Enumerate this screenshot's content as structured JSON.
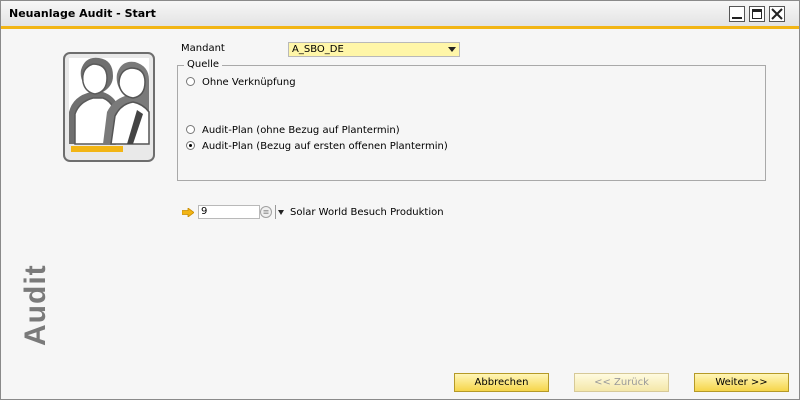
{
  "window": {
    "title": "Neuanlage Audit - Start"
  },
  "sidebar": {
    "label": "Audit",
    "icon": "users-icon"
  },
  "form": {
    "mandant_label": "Mandant",
    "mandant_value": "A_SBO_DE",
    "source_group_title": "Quelle",
    "radio_options": [
      {
        "label": "Ohne Verknüpfung",
        "selected": false
      },
      {
        "label": "Audit-Plan (ohne Bezug auf Plantermin)",
        "selected": false
      },
      {
        "label": "Audit-Plan (Bezug auf ersten offenen Plantermin)",
        "selected": true
      }
    ],
    "plan_number": "9",
    "plan_description": "Solar World Besuch Produktion"
  },
  "buttons": {
    "cancel": "Abbrechen",
    "back": "<< Zurück",
    "next": "Weiter >>"
  },
  "colors": {
    "accent": "#f2b515",
    "field_bg": "#fff6a8",
    "button_bg": "#f6d54a"
  }
}
